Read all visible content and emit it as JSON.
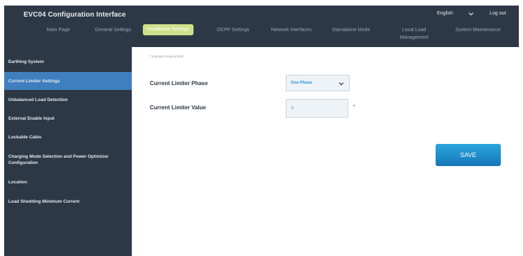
{
  "header": {
    "title": "EVC04 Configuration Interface",
    "language": "English",
    "logout_label": "Log out"
  },
  "nav": {
    "tabs": [
      {
        "label": "Main Page"
      },
      {
        "label": "General Settings"
      },
      {
        "label": "Installation Settings",
        "active": true
      },
      {
        "label": "OCPP Settings"
      },
      {
        "label": "Network Interfaces"
      },
      {
        "label": "Standalone Mode"
      },
      {
        "label": "Local Load Management"
      },
      {
        "label": "System Maintenance"
      }
    ]
  },
  "sidebar": {
    "items": [
      {
        "label": "Earthing System"
      },
      {
        "label": "Current Limiter Settings",
        "active": true
      },
      {
        "label": "Unbalanced Load Detection"
      },
      {
        "label": "External Enable Input"
      },
      {
        "label": "Lockable Cable"
      },
      {
        "label": "Charging Mode Selection and Power Optimizer Configuration"
      },
      {
        "label": "Location"
      },
      {
        "label": "Load Shedding Minimum Current"
      }
    ]
  },
  "main": {
    "required_note": "Indicates required field",
    "required_marker": "*",
    "phase_label": "Current Limiter Phase",
    "phase_value": "One Phase",
    "value_label": "Current Limiter Value",
    "value_value": "0",
    "save_label": "SAVE"
  },
  "colors": {
    "dark_panel": "#2d3846",
    "active_tab": "#cfe08a",
    "active_sidebar": "#3f7fbf",
    "accent": "#2a9ad8"
  },
  "icons": {
    "language_dropdown": "chevron-down-icon",
    "phase_dropdown": "chevron-down-icon"
  }
}
